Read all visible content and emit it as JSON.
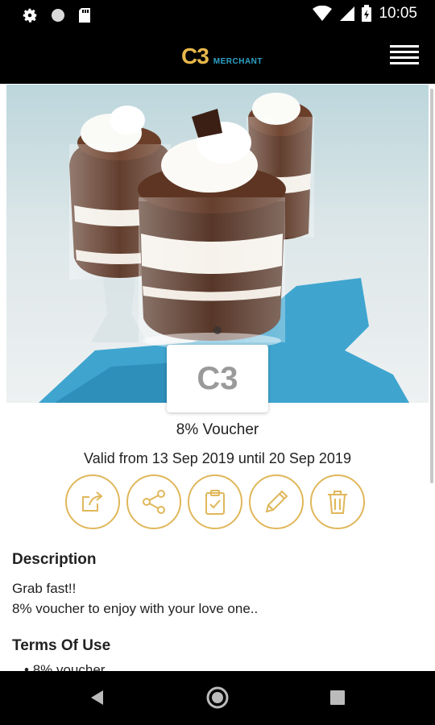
{
  "status_bar": {
    "time": "10:05",
    "left_icons": [
      "gear-icon",
      "circle-icon",
      "sd-card-icon"
    ],
    "right_icons": [
      "wifi-icon",
      "signal-icon",
      "battery-charging-icon"
    ]
  },
  "app_bar": {
    "logo_main": "C3",
    "logo_sub": "MERCHANT",
    "menu_icon": "hamburger-menu-icon"
  },
  "voucher": {
    "badge_text": "C3",
    "title": "8% Voucher",
    "validity": "Valid from 13 Sep 2019 until 20 Sep 2019"
  },
  "actions": [
    {
      "name": "open-external-button",
      "icon": "external-share-icon"
    },
    {
      "name": "share-button",
      "icon": "share-icon"
    },
    {
      "name": "clipboard-button",
      "icon": "clipboard-check-icon"
    },
    {
      "name": "edit-button",
      "icon": "pencil-icon"
    },
    {
      "name": "delete-button",
      "icon": "trash-icon"
    }
  ],
  "description": {
    "heading": "Description",
    "line1": "Grab fast!!",
    "line2": "8% voucher to enjoy with your love one.."
  },
  "terms": {
    "heading": "Terms Of Use",
    "item1": "8% voucher"
  },
  "colors": {
    "accent_gold": "#e0b75a",
    "logo_blue": "#2ca3c8",
    "bar_bg": "#000000"
  }
}
